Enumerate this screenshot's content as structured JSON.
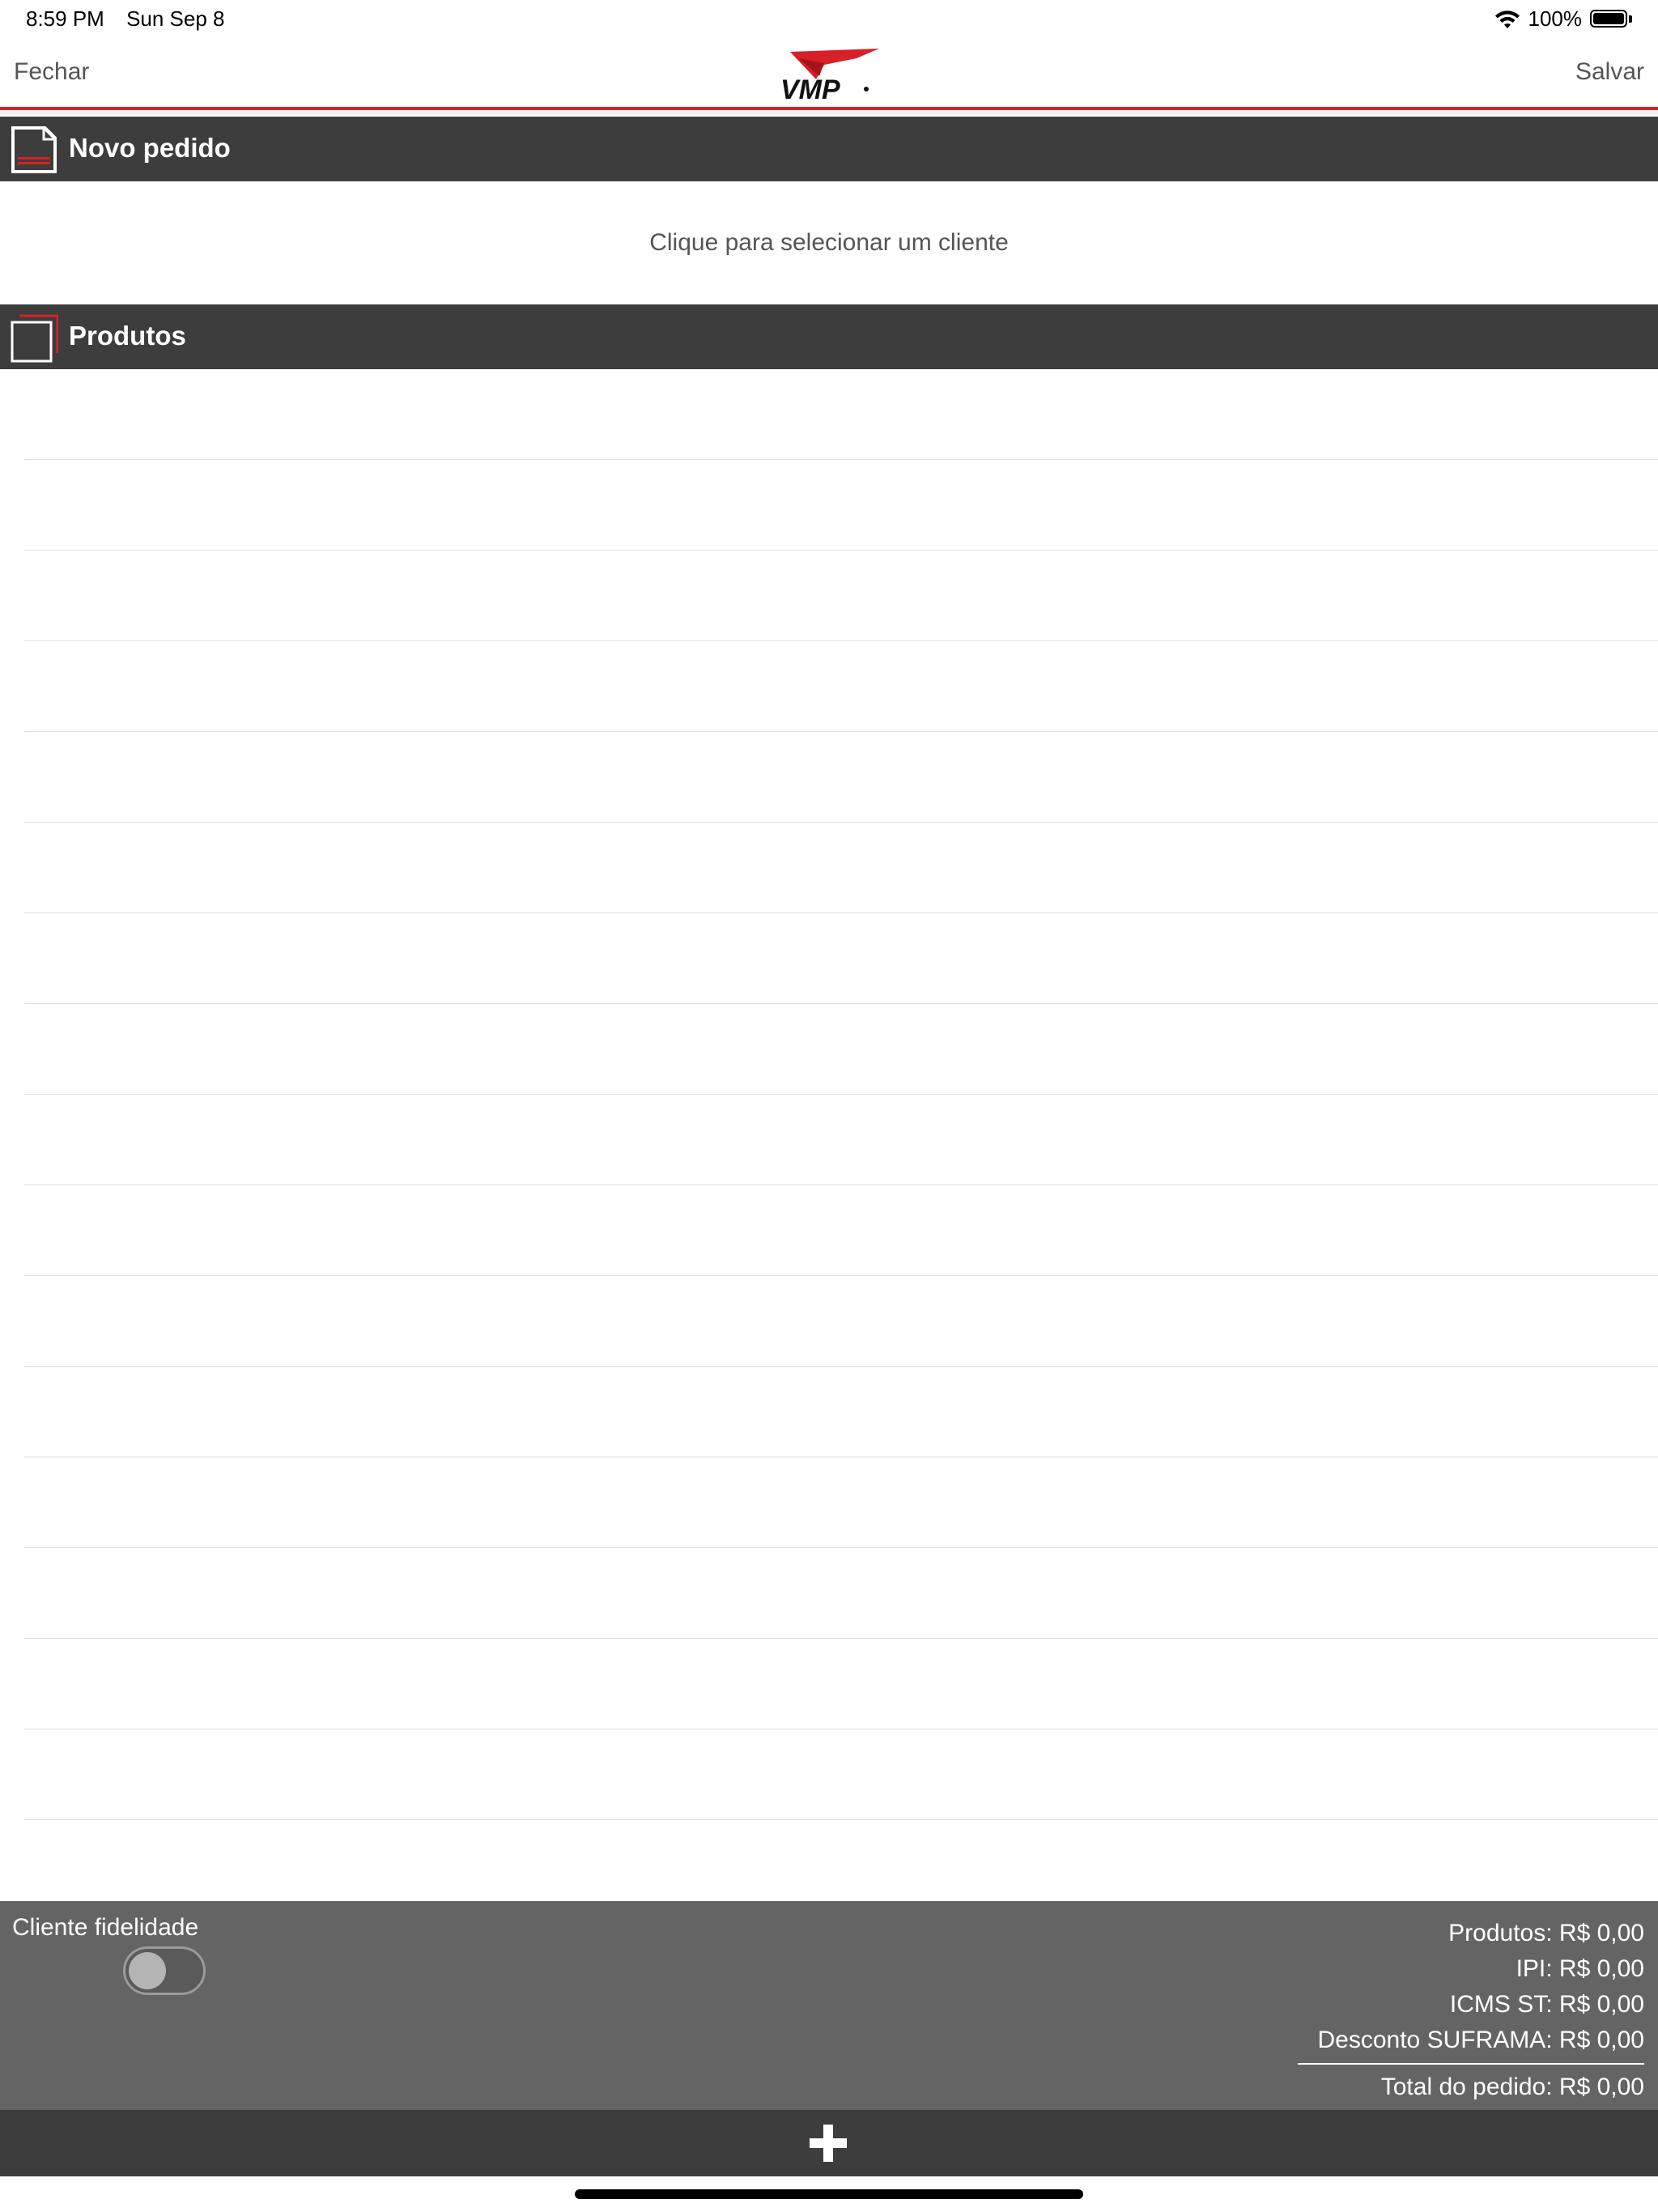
{
  "status_bar": {
    "time": "8:59 PM",
    "date": "Sun Sep 8",
    "battery": "100%"
  },
  "nav": {
    "close_label": "Fechar",
    "save_label": "Salvar",
    "logo_text": "VMP"
  },
  "order_section": {
    "title": "Novo pedido",
    "client_placeholder": "Clique para selecionar um cliente"
  },
  "products_section": {
    "title": "Produtos",
    "rows": [
      "",
      "",
      "",
      "",
      "",
      "",
      "",
      "",
      "",
      "",
      "",
      "",
      "",
      "",
      "",
      "",
      ""
    ]
  },
  "summary": {
    "loyalty_label": "Cliente fidelidade",
    "loyalty_enabled": false,
    "produtos": "Produtos: R$ 0,00",
    "ipi": "IPI: R$ 0,00",
    "icms_st": "ICMS ST: R$ 0,00",
    "desconto_suframa": "Desconto SUFRAMA: R$ 0,00",
    "total": "Total do pedido: R$ 0,00"
  },
  "colors": {
    "accent": "#d72027",
    "header_bg": "#3d3d3d",
    "summary_bg": "#646464"
  },
  "icons": [
    "wifi-icon",
    "battery-icon",
    "document-icon",
    "box-icon",
    "plus-icon"
  ]
}
